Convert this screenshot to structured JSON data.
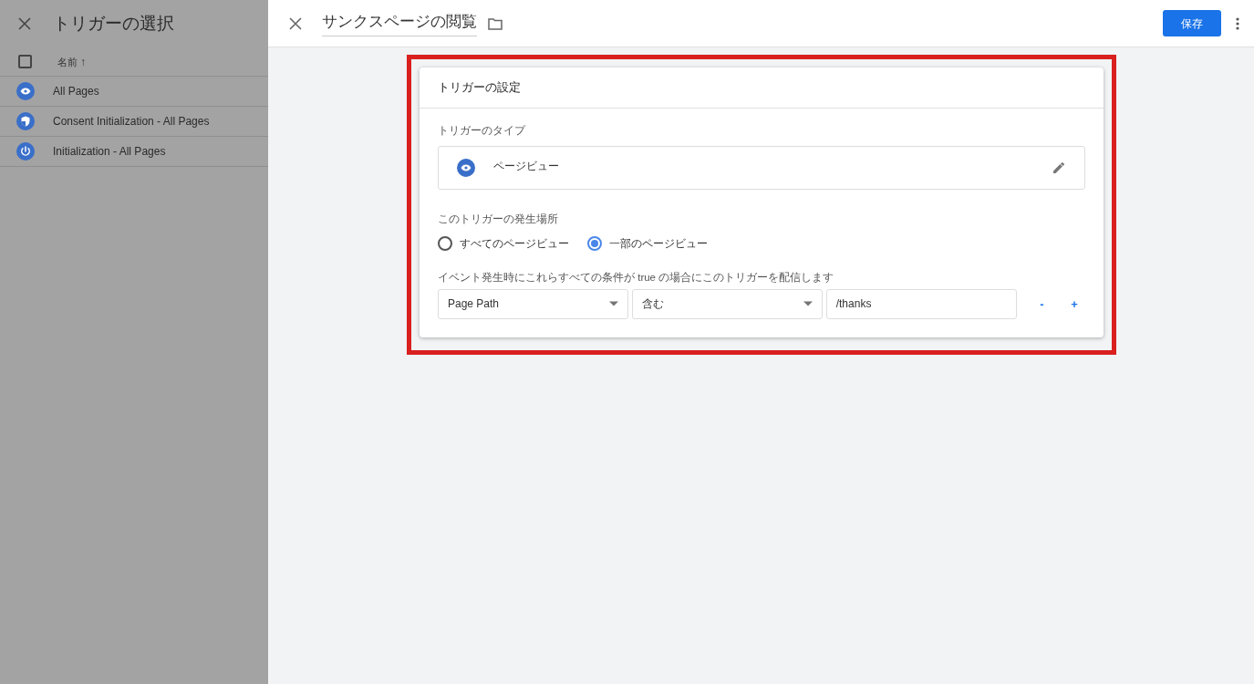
{
  "side_panel": {
    "title": "トリガーの選択",
    "header": {
      "checked": false,
      "label": "名前",
      "sort_icon": "↑"
    },
    "items": [
      {
        "kind": "eye",
        "label": "All Pages"
      },
      {
        "kind": "shield",
        "label": "Consent Initialization - All Pages"
      },
      {
        "kind": "power",
        "label": "Initialization - All Pages"
      }
    ]
  },
  "editor": {
    "title": "サンクスページの閲覧",
    "save_button": "保存",
    "card": {
      "title": "トリガーの設定",
      "type_label": "トリガーのタイプ",
      "type_value": "ページビュー",
      "scope_label": "このトリガーの発生場所",
      "scope_options": [
        {
          "label": "すべてのページビュー",
          "selected": false
        },
        {
          "label": "一部のページビュー",
          "selected": true
        }
      ],
      "condition_label": "イベント発生時にこれらすべての条件が true の場合にこのトリガーを配信します",
      "condition": {
        "variable": "Page Path",
        "operator": "含む",
        "value": "/thanks",
        "remove": "-",
        "add": "+"
      }
    }
  }
}
